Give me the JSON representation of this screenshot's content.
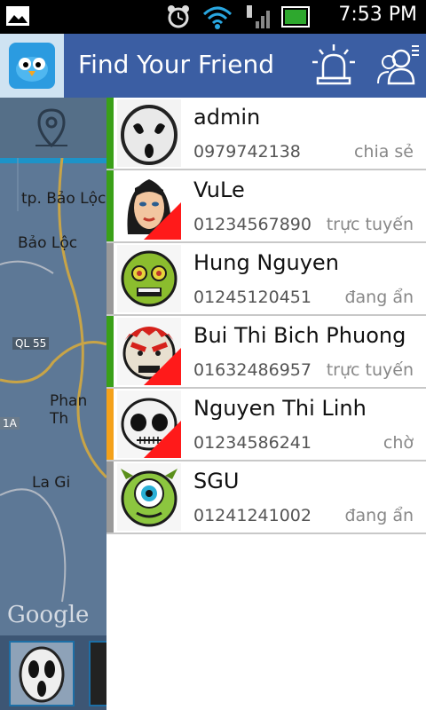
{
  "status_bar": {
    "time": "7:53 PM",
    "icons": [
      "image-icon",
      "alarm-clock-icon",
      "wifi-icon",
      "usb-signal-icon",
      "battery-icon"
    ]
  },
  "action_bar": {
    "title": "Find Your Friend",
    "icons": [
      "app-logo-icon",
      "alarm-siren-icon",
      "friends-menu-icon"
    ],
    "color": "#3b5ea3"
  },
  "map": {
    "labels": [
      "tp. Bảo Lộc",
      "Bảo Lộc",
      "QL 55",
      "Phan Th",
      "1A",
      "La Gi"
    ],
    "watermark": "Google"
  },
  "friends": [
    {
      "name": "admin",
      "phone": "0979742138",
      "status": "chia sẻ",
      "status_color": "#3aa018",
      "avatar": "scream-mask-avatar",
      "flag": false
    },
    {
      "name": "VuLe",
      "phone": "01234567890",
      "status": "trực tuyến",
      "status_color": "#3aa018",
      "avatar": "woman-face-avatar",
      "flag": true
    },
    {
      "name": "Hung Nguyen",
      "phone": "01245120451",
      "status": "đang ẩn",
      "status_color": "#9a9a9a",
      "avatar": "zombie-face-avatar",
      "flag": false
    },
    {
      "name": "Bui Thi Bich Phuong",
      "phone": "01632486957",
      "status": "trực tuyến",
      "status_color": "#3aa018",
      "avatar": "angry-face-avatar",
      "flag": true
    },
    {
      "name": "Nguyen Thi Linh",
      "phone": "01234586241",
      "status": "chờ",
      "status_color": "#f4a11a",
      "avatar": "skull-face-avatar",
      "flag": true
    },
    {
      "name": "SGU",
      "phone": "01241241002",
      "status": "đang ẩn",
      "status_color": "#9a9a9a",
      "avatar": "one-eye-monster-avatar",
      "flag": false
    }
  ]
}
